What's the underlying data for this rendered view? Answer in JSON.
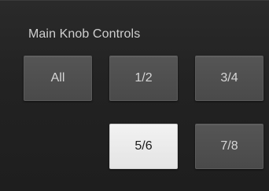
{
  "panel": {
    "title": "Main Knob Controls",
    "buttons": {
      "all": {
        "label": "All",
        "selected": false
      },
      "one_two": {
        "label": "1/2",
        "selected": false
      },
      "three_four": {
        "label": "3/4",
        "selected": false
      },
      "five_six": {
        "label": "5/6",
        "selected": true
      },
      "seven_eight": {
        "label": "7/8",
        "selected": false
      }
    },
    "colors": {
      "background": "#222222",
      "button": "#4d4d4d",
      "button_selected": "#ececec",
      "button_text": "#d6d6d6",
      "button_text_selected": "#1a1a1a",
      "title_text": "#cfcfcf"
    }
  }
}
